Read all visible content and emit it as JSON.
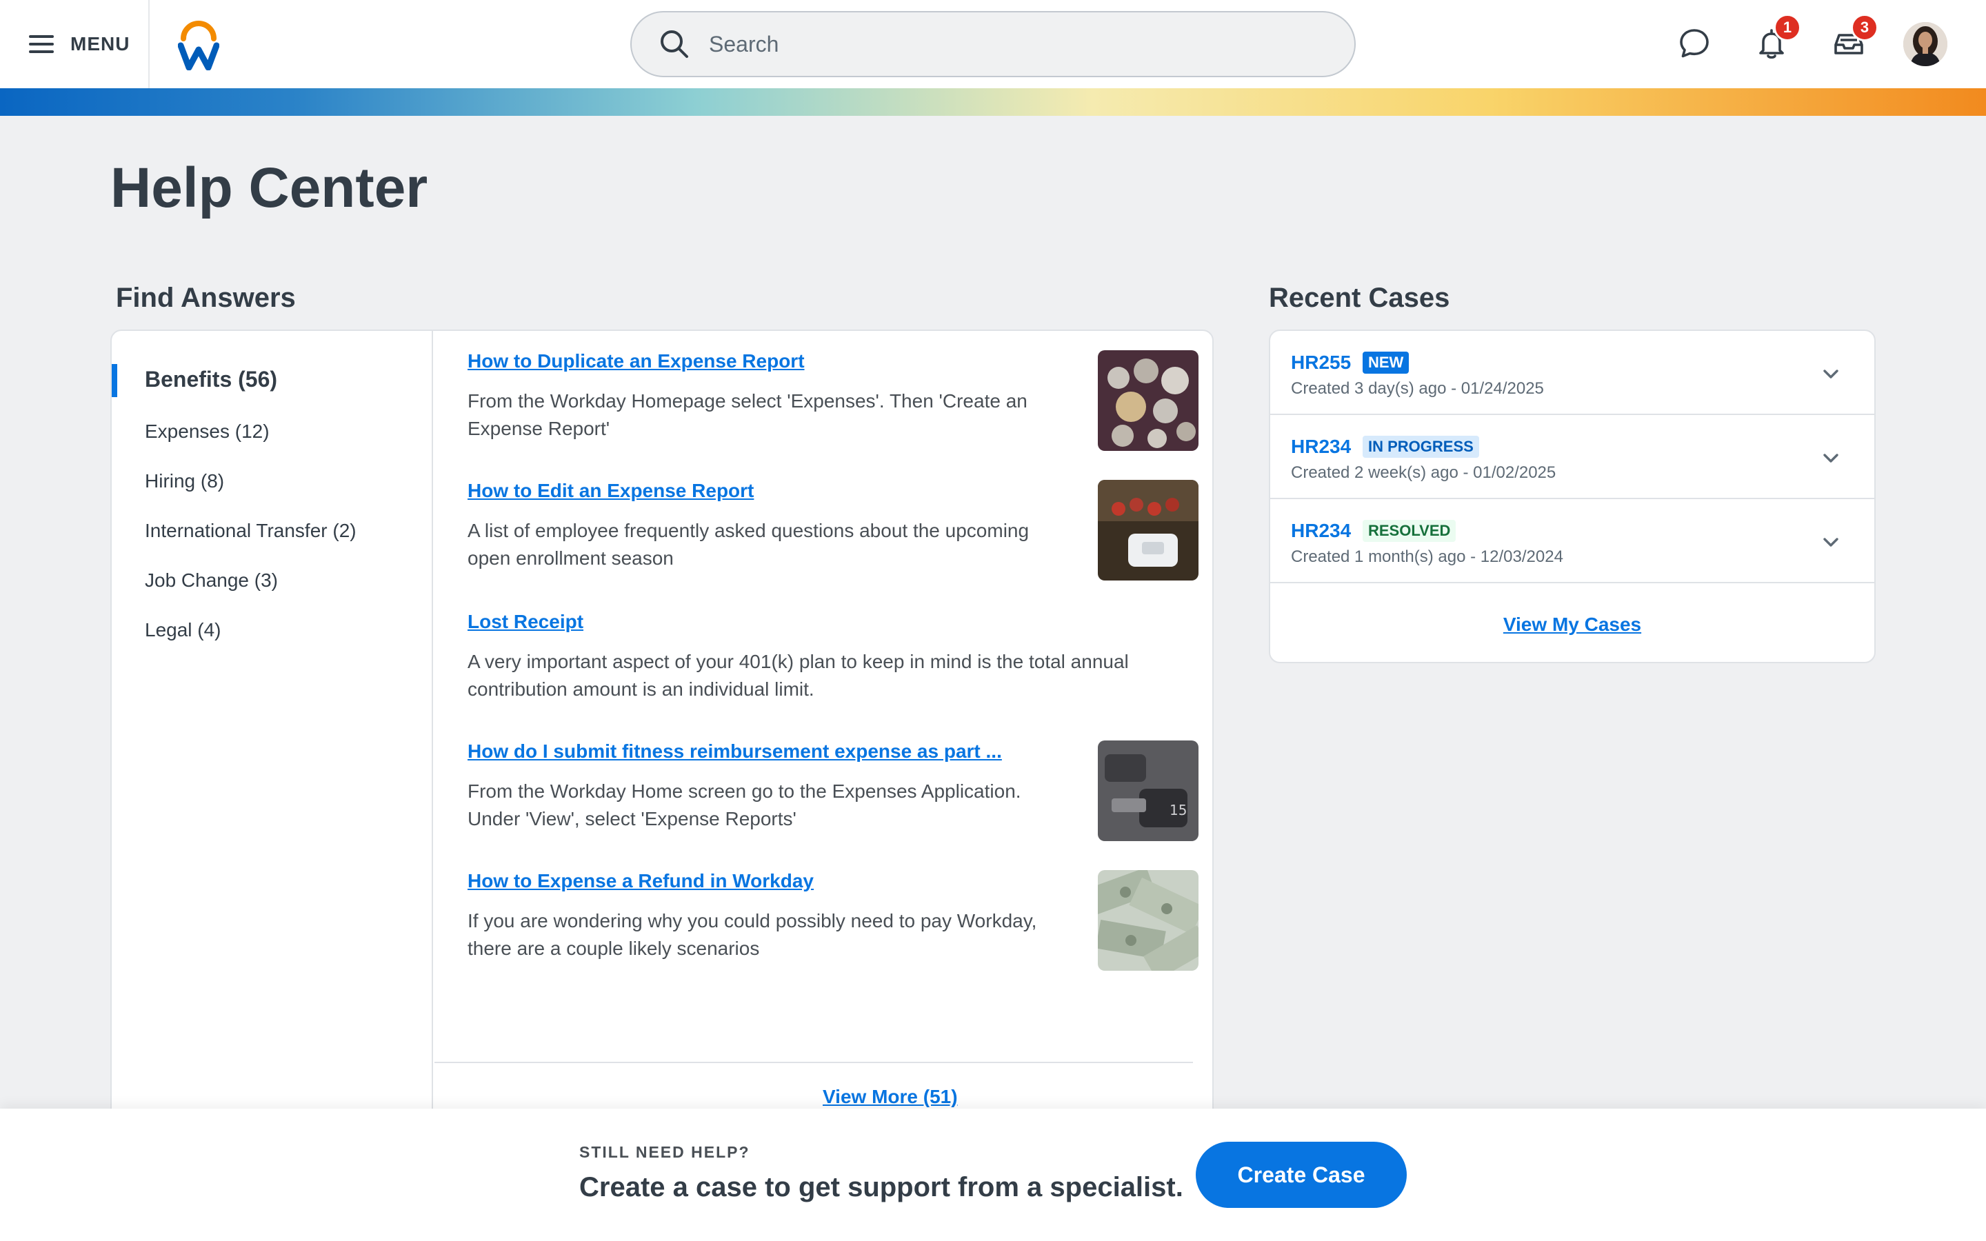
{
  "header": {
    "menu_label": "MENU",
    "search_placeholder": "Search",
    "notifications_count": "1",
    "inbox_count": "3",
    "brand_colors": {
      "primary": "#0875e1",
      "logo_orange": "#f38b00",
      "logo_blue": "#005cb9"
    }
  },
  "page": {
    "title": "Help Center"
  },
  "find_answers": {
    "title": "Find Answers",
    "categories": [
      {
        "label": "Benefits (56)",
        "active": true
      },
      {
        "label": "Expenses (12)"
      },
      {
        "label": "Hiring (8)"
      },
      {
        "label": "International Transfer (2)"
      },
      {
        "label": "Job Change (3)"
      },
      {
        "label": "Legal (4)"
      }
    ],
    "articles": [
      {
        "title": "How to Duplicate an Expense Report",
        "description": "From the Workday Homepage select 'Expenses'. Then 'Create an Expense Report'",
        "thumbnail": "coins-image"
      },
      {
        "title": "How to Edit an Expense Report",
        "description": "A list of employee frequently asked questions about the upcoming open enrollment season",
        "thumbnail": "card-reader-image"
      },
      {
        "title": "Lost Receipt",
        "description": "A very important aspect of your 401(k) plan to keep in mind is the total annual contribution amount is an individual limit."
      },
      {
        "title": "How do I submit fitness reimbursement expense as part ...",
        "description": "From the Workday Home screen go to the Expenses Application. Under 'View', select 'Expense Reports'",
        "thumbnail": "dumbbell-image"
      },
      {
        "title": "How to Expense a Refund in Workday",
        "description": "If you are wondering why you could possibly need to pay Workday, there are a couple likely scenarios",
        "thumbnail": "dollar-bills-image"
      }
    ],
    "view_more": "View More (51)"
  },
  "recent_cases": {
    "title": "Recent Cases",
    "cases": [
      {
        "id": "HR255",
        "status": "NEW",
        "meta": "Created 3 day(s) ago - 01/24/2025"
      },
      {
        "id": "HR234",
        "status": "IN PROGRESS",
        "meta": "Created 2 week(s) ago - 01/02/2025"
      },
      {
        "id": "HR234",
        "status": "RESOLVED",
        "meta": "Created 1 month(s) ago - 12/03/2024"
      }
    ],
    "view_cases": "View My Cases"
  },
  "footer": {
    "kicker": "STILL NEED HELP?",
    "message": "Create a case to get support from a specialist.",
    "button_label": "Create Case"
  }
}
